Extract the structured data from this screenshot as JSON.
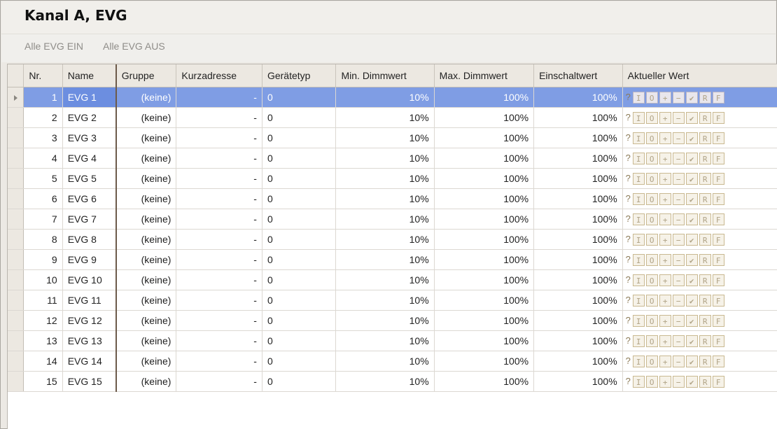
{
  "window": {
    "title": "Kanal A, EVG"
  },
  "toolbar": {
    "all_on": "Alle EVG EIN",
    "all_off": "Alle EVG AUS"
  },
  "columns": [
    "Nr.",
    "Name",
    "Gruppe",
    "Kurzadresse",
    "Gerätetyp",
    "Min. Dimmwert",
    "Max. Dimmwert",
    "Einschaltwert",
    "Aktueller Wert"
  ],
  "current_value_symbols": {
    "unknown": "?",
    "on": "I",
    "off": "O",
    "plus": "+",
    "minus": "−",
    "check": "✔",
    "r": "R",
    "f": "F"
  },
  "selected_row": 0,
  "rows": [
    {
      "nr": "1",
      "name": "EVG 1",
      "gruppe": "(keine)",
      "kurzadresse": "-",
      "typ": "0",
      "min": "10%",
      "max": "100%",
      "ein": "100%"
    },
    {
      "nr": "2",
      "name": "EVG 2",
      "gruppe": "(keine)",
      "kurzadresse": "-",
      "typ": "0",
      "min": "10%",
      "max": "100%",
      "ein": "100%"
    },
    {
      "nr": "3",
      "name": "EVG 3",
      "gruppe": "(keine)",
      "kurzadresse": "-",
      "typ": "0",
      "min": "10%",
      "max": "100%",
      "ein": "100%"
    },
    {
      "nr": "4",
      "name": "EVG 4",
      "gruppe": "(keine)",
      "kurzadresse": "-",
      "typ": "0",
      "min": "10%",
      "max": "100%",
      "ein": "100%"
    },
    {
      "nr": "5",
      "name": "EVG 5",
      "gruppe": "(keine)",
      "kurzadresse": "-",
      "typ": "0",
      "min": "10%",
      "max": "100%",
      "ein": "100%"
    },
    {
      "nr": "6",
      "name": "EVG 6",
      "gruppe": "(keine)",
      "kurzadresse": "-",
      "typ": "0",
      "min": "10%",
      "max": "100%",
      "ein": "100%"
    },
    {
      "nr": "7",
      "name": "EVG 7",
      "gruppe": "(keine)",
      "kurzadresse": "-",
      "typ": "0",
      "min": "10%",
      "max": "100%",
      "ein": "100%"
    },
    {
      "nr": "8",
      "name": "EVG 8",
      "gruppe": "(keine)",
      "kurzadresse": "-",
      "typ": "0",
      "min": "10%",
      "max": "100%",
      "ein": "100%"
    },
    {
      "nr": "9",
      "name": "EVG 9",
      "gruppe": "(keine)",
      "kurzadresse": "-",
      "typ": "0",
      "min": "10%",
      "max": "100%",
      "ein": "100%"
    },
    {
      "nr": "10",
      "name": "EVG 10",
      "gruppe": "(keine)",
      "kurzadresse": "-",
      "typ": "0",
      "min": "10%",
      "max": "100%",
      "ein": "100%"
    },
    {
      "nr": "11",
      "name": "EVG 11",
      "gruppe": "(keine)",
      "kurzadresse": "-",
      "typ": "0",
      "min": "10%",
      "max": "100%",
      "ein": "100%"
    },
    {
      "nr": "12",
      "name": "EVG 12",
      "gruppe": "(keine)",
      "kurzadresse": "-",
      "typ": "0",
      "min": "10%",
      "max": "100%",
      "ein": "100%"
    },
    {
      "nr": "13",
      "name": "EVG 13",
      "gruppe": "(keine)",
      "kurzadresse": "-",
      "typ": "0",
      "min": "10%",
      "max": "100%",
      "ein": "100%"
    },
    {
      "nr": "14",
      "name": "EVG 14",
      "gruppe": "(keine)",
      "kurzadresse": "-",
      "typ": "0",
      "min": "10%",
      "max": "100%",
      "ein": "100%"
    },
    {
      "nr": "15",
      "name": "EVG 15",
      "gruppe": "(keine)",
      "kurzadresse": "-",
      "typ": "0",
      "min": "10%",
      "max": "100%",
      "ein": "100%"
    }
  ],
  "colors": {
    "selection": "#7f9de4",
    "header_bg": "#ece8e1",
    "button_border": "#c9b991"
  }
}
